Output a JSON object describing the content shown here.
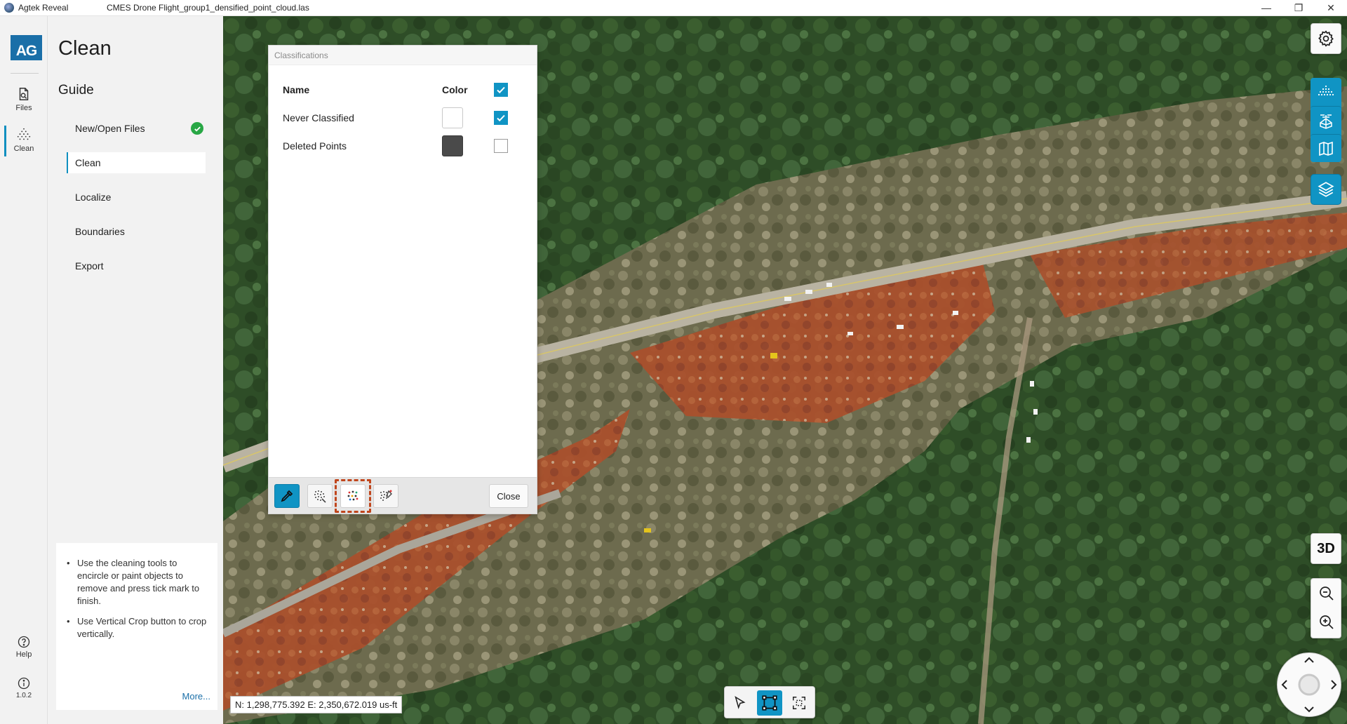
{
  "titlebar": {
    "app_name": "Agtek Reveal",
    "document_name": "CMES Drone Flight_group1_densified_point_cloud.las",
    "minimize": "—",
    "maximize": "❐",
    "close": "✕"
  },
  "rail": {
    "logo": "AG",
    "items": [
      {
        "label": "Files",
        "icon": "file-icon"
      },
      {
        "label": "Clean",
        "icon": "point-cloud-icon"
      }
    ],
    "help_label": "Help",
    "version_label": "1.0.2"
  },
  "guide": {
    "title": "Clean",
    "subtitle": "Guide",
    "steps": [
      {
        "label": "New/Open Files",
        "done": true
      },
      {
        "label": "Clean",
        "active": true
      },
      {
        "label": "Localize"
      },
      {
        "label": "Boundaries"
      },
      {
        "label": "Export"
      }
    ],
    "tips": [
      "Use the cleaning tools to encircle or paint objects to remove and press tick mark to finish.",
      "Use Vertical Crop button to crop vertically."
    ],
    "more_link": "More..."
  },
  "dialog": {
    "title": "Classifications",
    "col_name": "Name",
    "col_color": "Color",
    "rows": [
      {
        "name": "Never Classified",
        "color": "#ffffff",
        "checked": true
      },
      {
        "name": "Deleted Points",
        "color": "#4a4a4a",
        "checked": false
      }
    ],
    "close_label": "Close"
  },
  "map": {
    "coordinates": "N: 1,298,775.392 E: 2,350,672.019 us-ft",
    "view_mode_label": "3D"
  },
  "colors": {
    "accent": "#1094c4",
    "highlight": "#c0461d",
    "success": "#28a745"
  }
}
